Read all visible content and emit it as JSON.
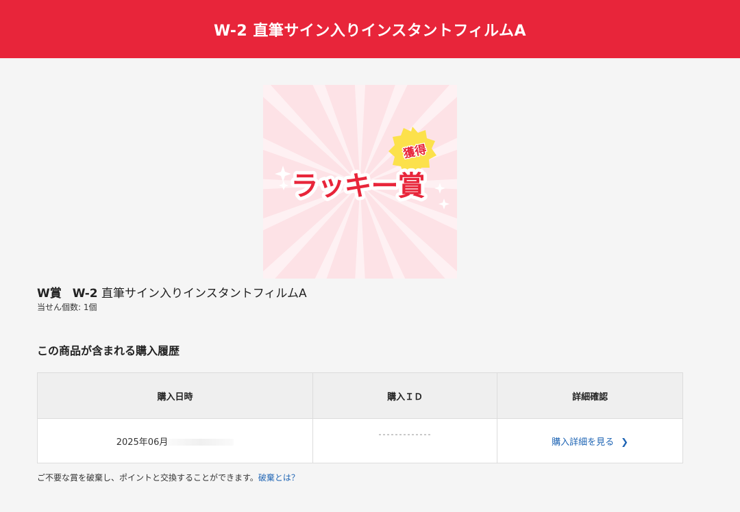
{
  "header": {
    "title": "W-2 直筆サイン入りインスタントフィルムA"
  },
  "prize": {
    "image_badge": "獲得",
    "image_label": "ラッキー賞",
    "rank": "W賞",
    "name_code": "W-2",
    "name_text": " 直筆サイン入りインスタントフィルムA",
    "count_label": "当せん個数: 1個"
  },
  "history": {
    "heading": "この商品が含まれる購入履歴",
    "columns": [
      "購入日時",
      "購入ＩＤ",
      "詳細確認"
    ],
    "rows": [
      {
        "date": "2025年06月",
        "detail_link": "購入詳細を見る"
      }
    ]
  },
  "footer": {
    "note": "ご不要な賞を破棄し、ポイントと交換することができます。",
    "link": "破棄とは？"
  },
  "colors": {
    "brand": "#e8253a",
    "link": "#1e64b4",
    "badge": "#fce14b"
  }
}
